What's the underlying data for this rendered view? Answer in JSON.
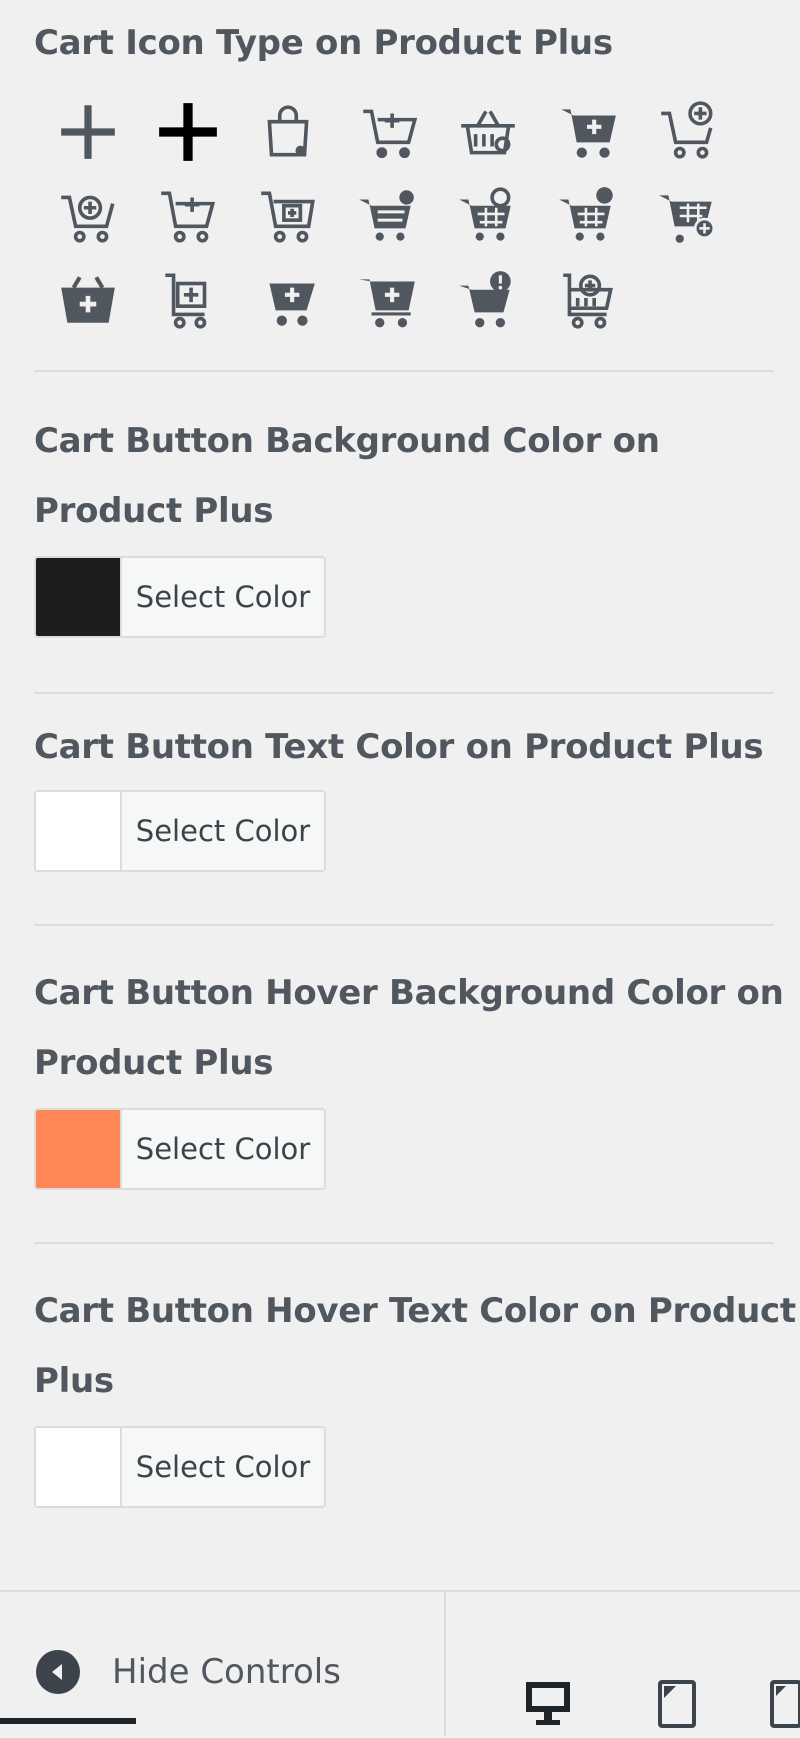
{
  "sections": {
    "icon_type": {
      "title": "Cart Icon Type on Product Plus"
    },
    "bg_color": {
      "title_line1": "Cart Button Background Color on",
      "title_line2": "Product Plus",
      "button_label": "Select Color",
      "value": "#1d1d1d"
    },
    "text_color": {
      "title": "Cart Button Text Color on Product Plus",
      "button_label": "Select Color",
      "value": "#ffffff"
    },
    "hover_bg_color": {
      "title_line1": "Cart Button Hover Background Color on",
      "title_line2": "Product Plus",
      "button_label": "Select Color",
      "value": "#ff8756"
    },
    "hover_text_color": {
      "title_line1": "Cart Button Hover Text Color on Product",
      "title_line2": "Plus",
      "button_label": "Select Color",
      "value": "#ffffff"
    }
  },
  "icons": [
    "plus-thin-icon",
    "plus-bold-icon",
    "shopping-bag-icon",
    "cart-add-line-icon",
    "basket-icon",
    "cart-solid-plus-icon",
    "cart-add-circle-icon",
    "cart-circle-plus-icon",
    "cart-plus-outline-icon",
    "cart-box-plus-icon",
    "cart-solid-badge-icon",
    "cart-badge-icon",
    "cart-solid-plus-badge-icon",
    "cart-solid-circle-icon",
    "basket-solid-plus-icon",
    "cart-square-plus-icon",
    "cart-solid-arrow-icon",
    "cart-solid-plus2-icon",
    "cart-exclaim-icon",
    "cart-circle-plus2-icon"
  ],
  "footer": {
    "hide_label": "Hide Controls"
  },
  "colors": {
    "icon": "#50575e",
    "icon_active": "#000000",
    "divider": "#dcdcde"
  }
}
